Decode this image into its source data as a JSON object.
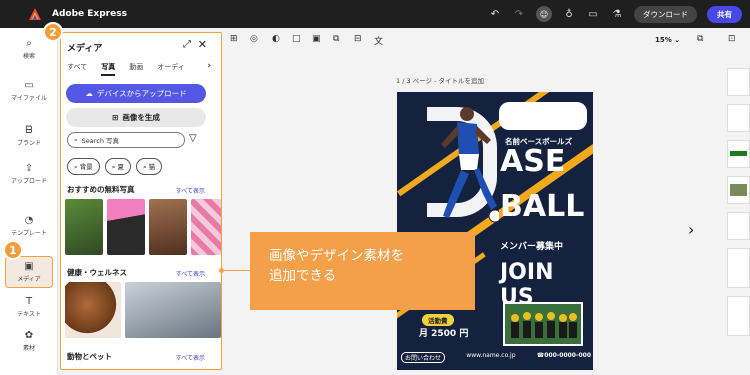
{
  "header": {
    "app_title": "Adobe Express",
    "download_label": "ダウンロード",
    "share_label": "共有"
  },
  "rail": {
    "items": [
      {
        "label": "検索",
        "icon": "search-icon"
      },
      {
        "label": "マイファイル",
        "icon": "folder-icon"
      },
      {
        "label": "ブランド",
        "icon": "brand-icon"
      },
      {
        "label": "アップロード",
        "icon": "upload-icon"
      },
      {
        "label": "テンプレート",
        "icon": "template-icon"
      },
      {
        "label": "メディア",
        "icon": "media-icon"
      },
      {
        "label": "テキスト",
        "icon": "text-icon"
      },
      {
        "label": "素材",
        "icon": "elements-icon"
      }
    ]
  },
  "badges": {
    "one": "1",
    "two": "2"
  },
  "panel": {
    "title": "メディア",
    "tabs": [
      "すべて",
      "写真",
      "動画",
      "オーディ"
    ],
    "active_tab": "写真",
    "upload_label": "デバイスからアップロード",
    "generate_label": "画像を生成",
    "search_placeholder": "Search 写真",
    "chips": [
      "背景",
      "夏",
      "猫"
    ],
    "sections": [
      {
        "title": "おすすめの無料写真",
        "see_all": "すべて表示"
      },
      {
        "title": "健康・ウェルネス",
        "see_all": "すべて表示"
      },
      {
        "title": "動物とペット",
        "see_all": "すべて表示"
      }
    ]
  },
  "canvas": {
    "zoom": "15%",
    "page_label": "1 / 3 ページ - タイトルを追加"
  },
  "poster": {
    "team_name": "名前ベースボールズ",
    "word1": "ASE",
    "word2": "BALL",
    "recruit": "メンバー募集中",
    "join": "JOIN US",
    "fee_label": "活動費",
    "fee": "月 2500 円",
    "url": "www.name.co.jp",
    "phone": "☎000-0000-000",
    "small_label": "お問い合わせ"
  },
  "callout": {
    "line1": "画像やデザイン素材を",
    "line2": "追加できる"
  }
}
